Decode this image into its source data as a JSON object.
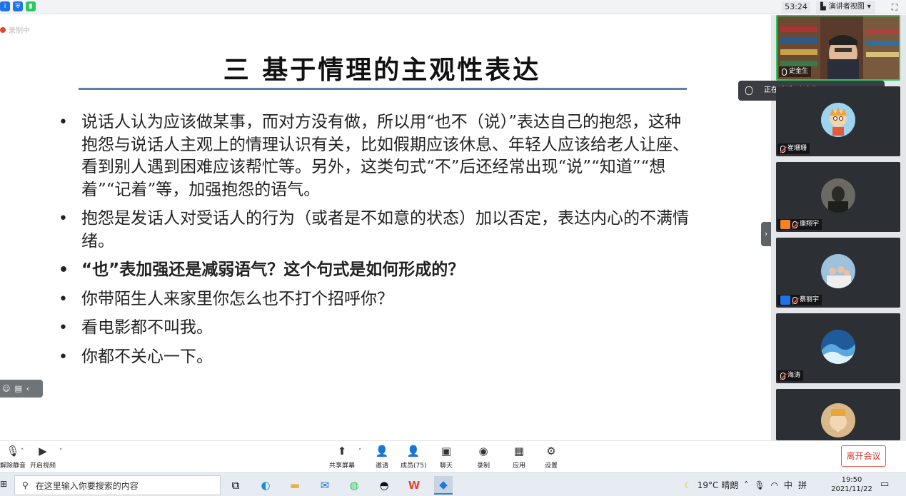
{
  "topbar": {
    "timer": "53:24",
    "presenter_view": "演讲者视图",
    "presenter_caret": "▾",
    "fullscreen_glyph": "⛶"
  },
  "slide": {
    "recording_label": "录制中",
    "title": "三  基于情理的主观性表达",
    "bullets": [
      "说话人认为应该做某事，而对方没有做，所以用“也不（说）”表达自己的抱怨，这种抱怨与说话人主观上的情理认识有关，比如假期应该休息、年轻人应该给老人让座、看到别人遇到困难应该帮忙等。另外，这类句式“不”后还经常出现“说”“知道”“想着”“记着”等，加强抱怨的语气。",
      "抱怨是发话人对受话人的行为（或者是不如意的状态）加以否定，表达内心的不满情绪。",
      "“也”表加强还是减弱语气？这个句式是如何形成的？",
      "你带陌生人来家里你怎么也不打个招呼你？",
      "看电影都不叫我。",
      "你都不关心一下。"
    ],
    "title_rule_color": "#5b7fa8"
  },
  "speaking": {
    "text": "正在讲话: 史金生;"
  },
  "participants": [
    {
      "name": "史金生",
      "type": "video",
      "active": true
    },
    {
      "name": "崔珊珊",
      "type": "avatar",
      "avatar_color": "#9ed4f0"
    },
    {
      "name": "康翔宇",
      "type": "avatar",
      "avatar_color": "#4a4a46",
      "badge_color": "#f58220"
    },
    {
      "name": "蔡丽宇",
      "type": "avatar",
      "avatar_color": "#8fb7d6",
      "badge_color": "#1e73e8"
    },
    {
      "name": "海涛",
      "type": "avatar",
      "avatar_color": "#1f5a9a"
    },
    {
      "name": "",
      "type": "avatar",
      "avatar_color": "#d9b98a"
    }
  ],
  "toolbar": {
    "mute_label": "解除静音",
    "video_label": "开启视频",
    "share_label": "共享屏幕",
    "invite_label": "邀请",
    "members_label": "成员(75)",
    "chat_label": "聊天",
    "record_label": "录制",
    "apps_label": "应用",
    "settings_label": "设置",
    "leave_label": "离开会议"
  },
  "taskbar": {
    "search_placeholder": "在这里输入你要搜索的内容",
    "weather": "19°C 晴朗",
    "ime": "中",
    "ime_mode": "拼",
    "time": "19:50",
    "date": "2021/11/22"
  },
  "colors": {
    "leave_red": "#d9372c",
    "active_green": "#2dc85f"
  }
}
